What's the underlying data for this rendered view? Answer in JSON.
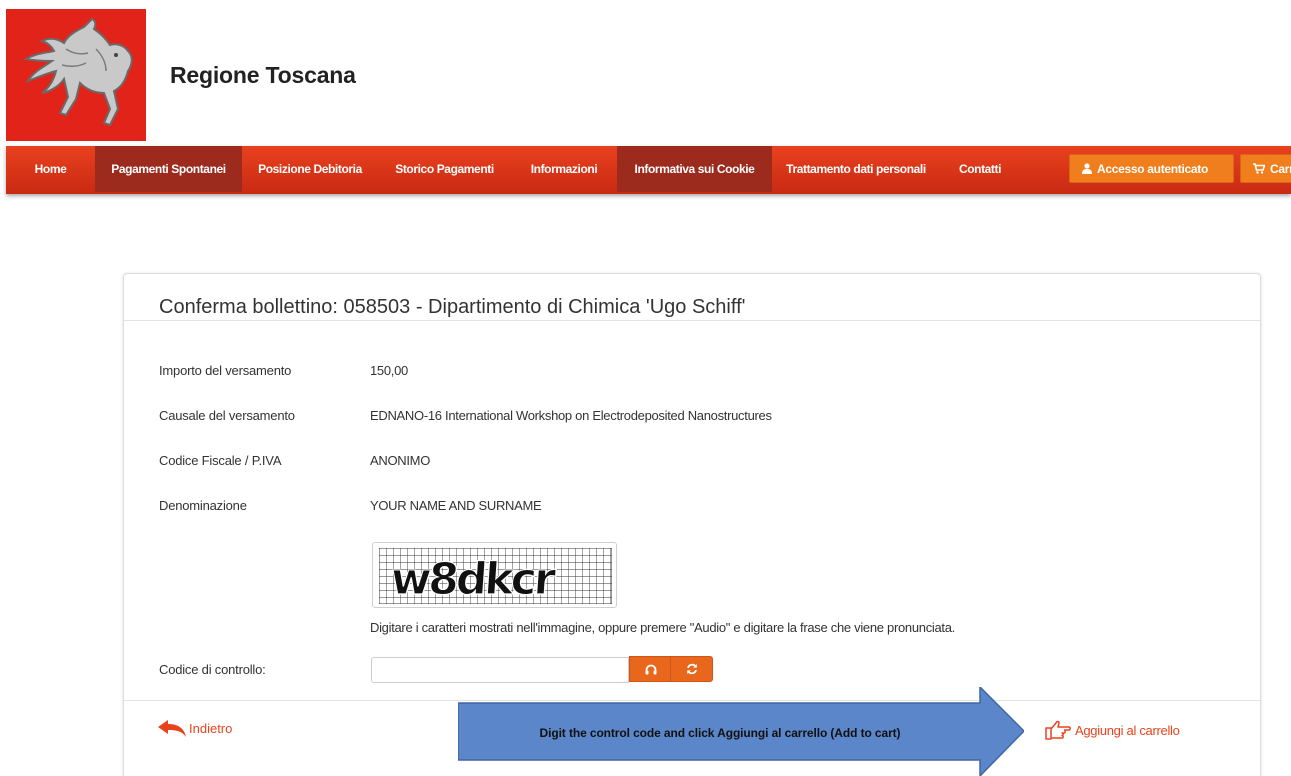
{
  "header": {
    "brand": "Regione Toscana"
  },
  "nav": {
    "items": [
      {
        "label": "Home",
        "active": false
      },
      {
        "label": "Pagamenti Spontanei",
        "active": true
      },
      {
        "label": "Posizione Debitoria",
        "active": false
      },
      {
        "label": "Storico Pagamenti",
        "active": false
      },
      {
        "label": "Informazioni",
        "active": false
      },
      {
        "label": "Informativa sui Cookie",
        "active": true
      },
      {
        "label": "Trattamento dati personali",
        "active": false
      },
      {
        "label": "Contatti",
        "active": false
      }
    ],
    "login_button": "Accesso autenticato",
    "cart_button": "Carrello"
  },
  "panel": {
    "title": "Conferma bollettino: 058503 - Dipartimento di Chimica 'Ugo Schiff'",
    "fields": [
      {
        "label": "Importo del versamento",
        "value": "150,00"
      },
      {
        "label": "Causale del versamento",
        "value": "EDNANO-16 International Workshop on Electrodeposited Nanostructures"
      },
      {
        "label": "Codice Fiscale / P.IVA",
        "value": "ANONIMO"
      },
      {
        "label": "Denominazione",
        "value": "YOUR NAME AND SURNAME"
      }
    ],
    "captcha_text": "w8dkcr",
    "captcha_hint": "Digitare i caratteri mostrati nell'immagine, oppure premere \"Audio\" e digitare la frase che viene pronunciata.",
    "code_label": "Codice di controllo:",
    "code_value": "",
    "back_label": "Indietro",
    "add_label": "Aggiungi al carrello"
  },
  "annotation": {
    "text": "Digit the control code and click Aggiungi al carrello (Add to cart)",
    "color": "#5b86c9"
  },
  "colors": {
    "brand_red": "#e2231a",
    "nav_active": "#9c2b1e",
    "orange": "#f07e1d",
    "link": "#e8431d"
  }
}
